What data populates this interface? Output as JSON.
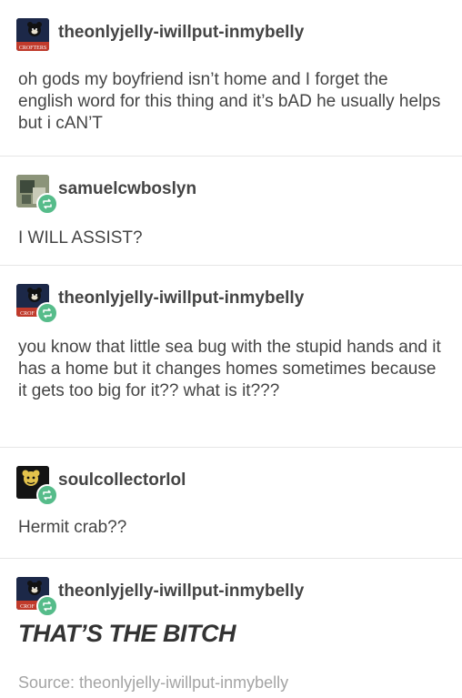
{
  "posts": [
    {
      "username": "theonlyjelly-iwillput-inmybelly",
      "avatar_icon": "bear-avatar-icon",
      "avatar_caption": "CROFTERS",
      "text": "oh gods my boyfriend isn’t home and I forget the english word for this thing and it’s bAD he usually helps but i cAN’T"
    },
    {
      "username": "samuelcwboslyn",
      "avatar_icon": "photo-avatar-icon",
      "text": "I WILL ASSIST?"
    },
    {
      "username": "theonlyjelly-iwillput-inmybelly",
      "avatar_icon": "bear-avatar-icon",
      "avatar_caption": "CROF",
      "text": "you know that little sea bug with the stupid hands and it has a home but it changes homes sometimes because it gets too big for it?? what is it???"
    },
    {
      "username": "soulcollectorlol",
      "avatar_icon": "cartoon-avatar-icon",
      "text": "Hermit crab??"
    },
    {
      "username": "theonlyjelly-iwillput-inmybelly",
      "avatar_icon": "bear-avatar-icon",
      "avatar_caption": "CROF",
      "text": "THAT’S THE BITCH"
    }
  ],
  "source": "Source: theonlyjelly-iwillput-inmybelly",
  "colors": {
    "reblog_green": "#56bc8a",
    "text": "#444444",
    "divider": "#e6e6e6",
    "source_text": "#a4a4a4"
  }
}
